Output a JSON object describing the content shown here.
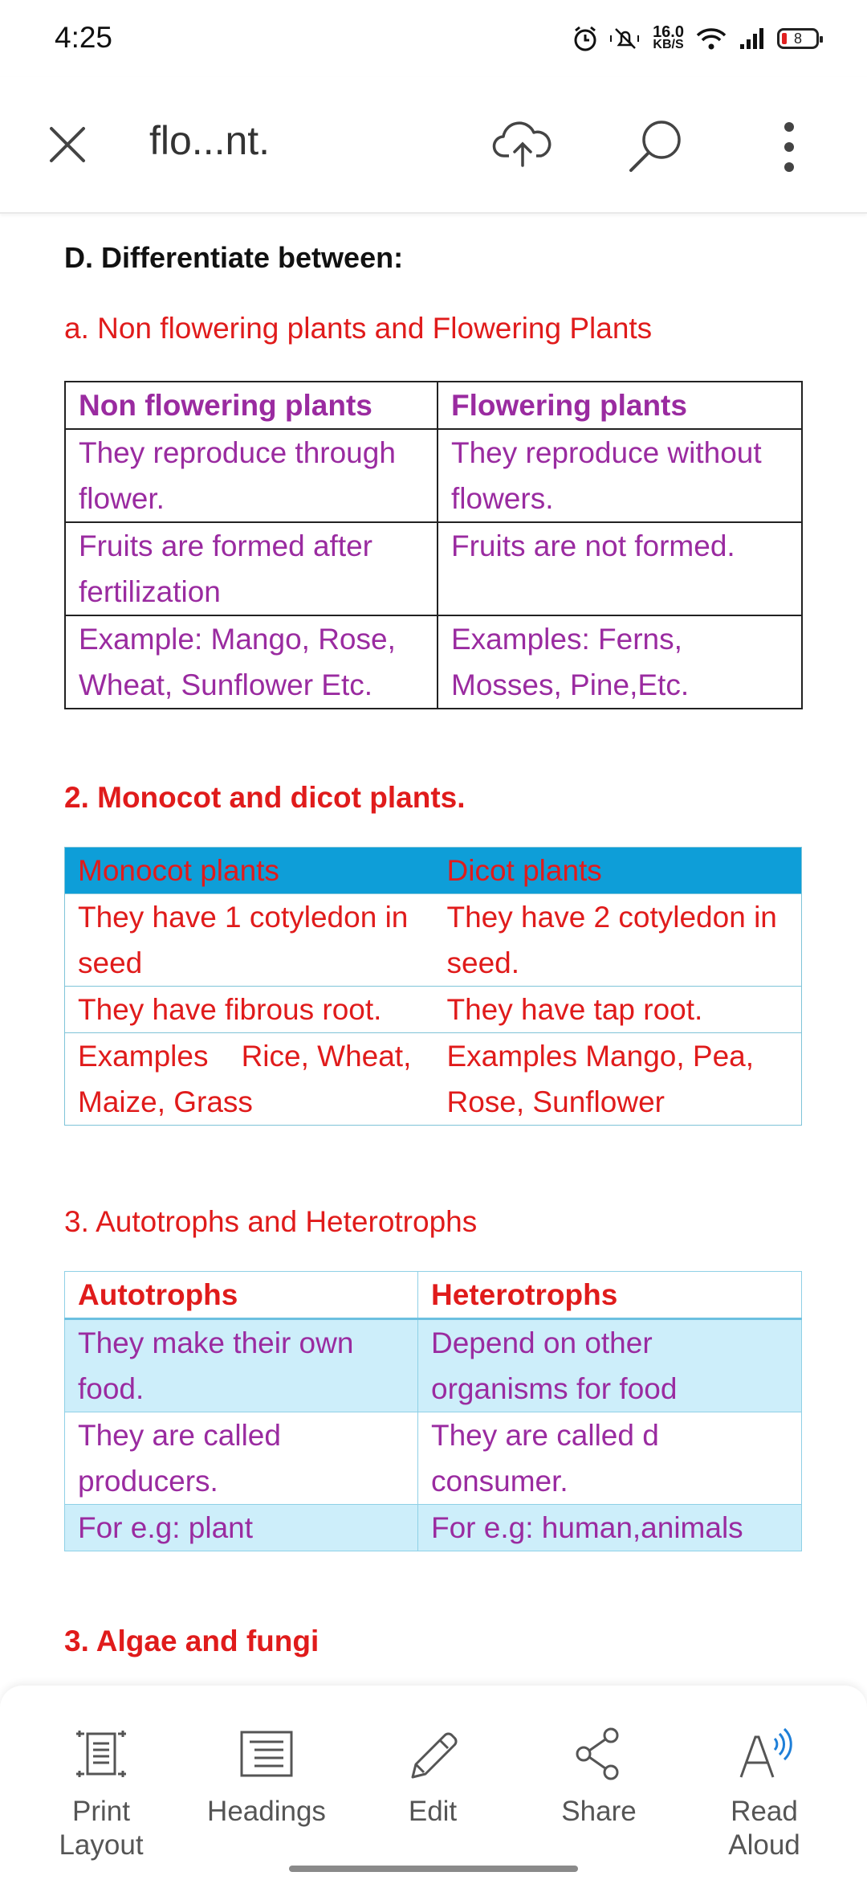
{
  "status": {
    "time": "4:25",
    "speed_value": "16.0",
    "speed_unit": "KB/S",
    "battery": "8"
  },
  "appbar": {
    "title": "flo...nt."
  },
  "doc": {
    "section_heading": "D. Differentiate between:",
    "a_heading": "a. Non flowering plants and Flowering Plants",
    "table1": {
      "headers": [
        "Non flowering plants",
        "Flowering plants"
      ],
      "rows": [
        [
          "They reproduce through flower.",
          "They reproduce without flowers."
        ],
        [
          "Fruits are formed after fertilization",
          "Fruits are not formed."
        ],
        [
          "Example: Mango, Rose, Wheat, Sunflower Etc.",
          "Examples: Ferns, Mosses, Pine,Etc."
        ]
      ]
    },
    "b_heading": "2. Monocot and dicot plants.",
    "table2": {
      "headers": [
        "Monocot plants",
        "Dicot plants"
      ],
      "rows": [
        [
          "They have 1 cotyledon in seed",
          "They have 2 cotyledon in seed."
        ],
        [
          "They have fibrous root.",
          "They have tap root."
        ],
        [
          "Examples    Rice, Wheat, Maize, Grass",
          "Examples Mango, Pea, Rose, Sunflower"
        ]
      ]
    },
    "c_heading": "3. Autotrophs and Heterotrophs",
    "table3": {
      "headers": [
        "Autotrophs",
        "Heterotrophs"
      ],
      "rows": [
        [
          "They make their own food.",
          "Depend on other organisms for food"
        ],
        [
          "They are called producers.",
          "They are called d consumer."
        ],
        [
          "For e.g: plant",
          "For e.g: human,animals"
        ]
      ]
    },
    "d_heading": "3. Algae and fungi"
  },
  "toolbar": {
    "items": [
      {
        "label": "Print Layout",
        "icon": "print-layout-icon"
      },
      {
        "label": "Headings",
        "icon": "headings-icon"
      },
      {
        "label": "Edit",
        "icon": "pencil-icon"
      },
      {
        "label": "Share",
        "icon": "share-icon"
      },
      {
        "label": "Read Aloud",
        "icon": "read-aloud-icon"
      }
    ]
  },
  "colors": {
    "red": "#e01b1b",
    "purple": "#9a2ba0",
    "blue_header": "#0e9ed8",
    "light_blue": "#cdeefa"
  }
}
